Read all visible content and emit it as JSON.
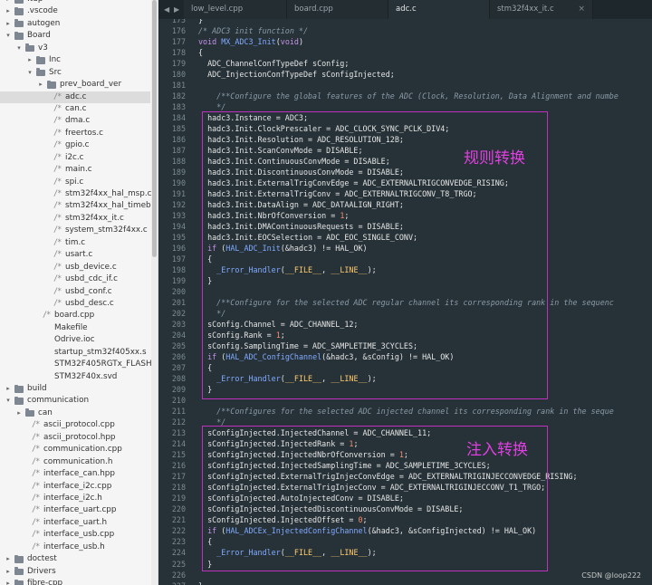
{
  "sidebar": {
    "items": [
      {
        "label": ".tup",
        "kind": "folder",
        "depth": 0,
        "expanded": false
      },
      {
        "label": ".vscode",
        "kind": "folder",
        "depth": 0,
        "expanded": false
      },
      {
        "label": "autogen",
        "kind": "folder",
        "depth": 0,
        "expanded": false
      },
      {
        "label": "Board",
        "kind": "folder",
        "depth": 0,
        "expanded": true
      },
      {
        "label": "v3",
        "kind": "folder",
        "depth": 1,
        "expanded": true
      },
      {
        "label": "Inc",
        "kind": "folder",
        "depth": 2,
        "expanded": false
      },
      {
        "label": "Src",
        "kind": "folder",
        "depth": 2,
        "expanded": true
      },
      {
        "label": "prev_board_ver",
        "kind": "folder",
        "depth": 3,
        "expanded": false
      },
      {
        "label": "adc.c",
        "kind": "file",
        "depth": 3,
        "icon": "/*",
        "selected": true
      },
      {
        "label": "can.c",
        "kind": "file",
        "depth": 3,
        "icon": "/*"
      },
      {
        "label": "dma.c",
        "kind": "file",
        "depth": 3,
        "icon": "/*"
      },
      {
        "label": "freertos.c",
        "kind": "file",
        "depth": 3,
        "icon": "/*"
      },
      {
        "label": "gpio.c",
        "kind": "file",
        "depth": 3,
        "icon": "/*"
      },
      {
        "label": "i2c.c",
        "kind": "file",
        "depth": 3,
        "icon": "/*"
      },
      {
        "label": "main.c",
        "kind": "file",
        "depth": 3,
        "icon": "/*"
      },
      {
        "label": "spi.c",
        "kind": "file",
        "depth": 3,
        "icon": "/*"
      },
      {
        "label": "stm32f4xx_hal_msp.c",
        "kind": "file",
        "depth": 3,
        "icon": "/*"
      },
      {
        "label": "stm32f4xx_hal_timebase_TIM.c",
        "kind": "file",
        "depth": 3,
        "icon": "/*"
      },
      {
        "label": "stm32f4xx_it.c",
        "kind": "file",
        "depth": 3,
        "icon": "/*"
      },
      {
        "label": "system_stm32f4xx.c",
        "kind": "file",
        "depth": 3,
        "icon": "/*"
      },
      {
        "label": "tim.c",
        "kind": "file",
        "depth": 3,
        "icon": "/*"
      },
      {
        "label": "usart.c",
        "kind": "file",
        "depth": 3,
        "icon": "/*"
      },
      {
        "label": "usb_device.c",
        "kind": "file",
        "depth": 3,
        "icon": "/*"
      },
      {
        "label": "usbd_cdc_if.c",
        "kind": "file",
        "depth": 3,
        "icon": "/*"
      },
      {
        "label": "usbd_conf.c",
        "kind": "file",
        "depth": 3,
        "icon": "/*"
      },
      {
        "label": "usbd_desc.c",
        "kind": "file",
        "depth": 3,
        "icon": "/*"
      },
      {
        "label": "board.cpp",
        "kind": "file",
        "depth": 2,
        "icon": "/*"
      },
      {
        "label": "Makefile",
        "kind": "file",
        "depth": 2,
        "icon": ""
      },
      {
        "label": "Odrive.ioc",
        "kind": "file",
        "depth": 2,
        "icon": ""
      },
      {
        "label": "startup_stm32f405xx.s",
        "kind": "file",
        "depth": 2,
        "icon": ""
      },
      {
        "label": "STM32F405RGTx_FLASH.ld",
        "kind": "file",
        "depth": 2,
        "icon": ""
      },
      {
        "label": "STM32F40x.svd",
        "kind": "file",
        "depth": 2,
        "icon": ""
      },
      {
        "label": "build",
        "kind": "folder",
        "depth": 0,
        "expanded": false
      },
      {
        "label": "communication",
        "kind": "folder",
        "depth": 0,
        "expanded": true
      },
      {
        "label": "can",
        "kind": "folder",
        "depth": 1,
        "expanded": false
      },
      {
        "label": "ascii_protocol.cpp",
        "kind": "file",
        "depth": 1,
        "icon": "/*"
      },
      {
        "label": "ascii_protocol.hpp",
        "kind": "file",
        "depth": 1,
        "icon": "/*"
      },
      {
        "label": "communication.cpp",
        "kind": "file",
        "depth": 1,
        "icon": "/*"
      },
      {
        "label": "communication.h",
        "kind": "file",
        "depth": 1,
        "icon": "/*"
      },
      {
        "label": "interface_can.hpp",
        "kind": "file",
        "depth": 1,
        "icon": "/*"
      },
      {
        "label": "interface_i2c.cpp",
        "kind": "file",
        "depth": 1,
        "icon": "/*"
      },
      {
        "label": "interface_i2c.h",
        "kind": "file",
        "depth": 1,
        "icon": "/*"
      },
      {
        "label": "interface_uart.cpp",
        "kind": "file",
        "depth": 1,
        "icon": "/*"
      },
      {
        "label": "interface_uart.h",
        "kind": "file",
        "depth": 1,
        "icon": "/*"
      },
      {
        "label": "interface_usb.cpp",
        "kind": "file",
        "depth": 1,
        "icon": "/*"
      },
      {
        "label": "interface_usb.h",
        "kind": "file",
        "depth": 1,
        "icon": "/*"
      },
      {
        "label": "doctest",
        "kind": "folder",
        "depth": 0,
        "expanded": false
      },
      {
        "label": "Drivers",
        "kind": "folder",
        "depth": 0,
        "expanded": false
      },
      {
        "label": "fibre-cpp",
        "kind": "folder",
        "depth": 0,
        "expanded": false
      }
    ]
  },
  "tabs": [
    {
      "label": "low_level.cpp",
      "active": false
    },
    {
      "label": "board.cpp",
      "active": false
    },
    {
      "label": "adc.c",
      "active": true
    },
    {
      "label": "stm32f4xx_it.c",
      "active": false
    }
  ],
  "tab_controls": {
    "left_arrow": "◀",
    "right_arrow": "▶",
    "close": "×"
  },
  "editor": {
    "lines": [
      {
        "n": "175",
        "text": "}"
      },
      {
        "n": "176",
        "text": "/* ADC3 init function */"
      },
      {
        "n": "177",
        "text": "void MX_ADC3_Init(void)"
      },
      {
        "n": "178",
        "text": "{"
      },
      {
        "n": "179",
        "text": "  ADC_ChannelConfTypeDef sConfig;"
      },
      {
        "n": "180",
        "text": "  ADC_InjectionConfTypeDef sConfigInjected;"
      },
      {
        "n": "181",
        "text": ""
      },
      {
        "n": "182",
        "text": "    /**Configure the global features of the ADC (Clock, Resolution, Data Alignment and numbe"
      },
      {
        "n": "183",
        "text": "    */"
      },
      {
        "n": "184",
        "text": "  hadc3.Instance = ADC3;"
      },
      {
        "n": "185",
        "text": "  hadc3.Init.ClockPrescaler = ADC_CLOCK_SYNC_PCLK_DIV4;"
      },
      {
        "n": "186",
        "text": "  hadc3.Init.Resolution = ADC_RESOLUTION_12B;"
      },
      {
        "n": "187",
        "text": "  hadc3.Init.ScanConvMode = DISABLE;"
      },
      {
        "n": "188",
        "text": "  hadc3.Init.ContinuousConvMode = DISABLE;"
      },
      {
        "n": "189",
        "text": "  hadc3.Init.DiscontinuousConvMode = DISABLE;"
      },
      {
        "n": "190",
        "text": "  hadc3.Init.ExternalTrigConvEdge = ADC_EXTERNALTRIGCONVEDGE_RISING;"
      },
      {
        "n": "191",
        "text": "  hadc3.Init.ExternalTrigConv = ADC_EXTERNALTRIGCONV_T8_TRGO;"
      },
      {
        "n": "192",
        "text": "  hadc3.Init.DataAlign = ADC_DATAALIGN_RIGHT;"
      },
      {
        "n": "193",
        "text": "  hadc3.Init.NbrOfConversion = 1;"
      },
      {
        "n": "194",
        "text": "  hadc3.Init.DMAContinuousRequests = DISABLE;"
      },
      {
        "n": "195",
        "text": "  hadc3.Init.EOCSelection = ADC_EOC_SINGLE_CONV;"
      },
      {
        "n": "196",
        "text": "  if (HAL_ADC_Init(&hadc3) != HAL_OK)"
      },
      {
        "n": "197",
        "text": "  {"
      },
      {
        "n": "198",
        "text": "    _Error_Handler(__FILE__, __LINE__);"
      },
      {
        "n": "199",
        "text": "  }"
      },
      {
        "n": "200",
        "text": ""
      },
      {
        "n": "201",
        "text": "    /**Configure for the selected ADC regular channel its corresponding rank in the sequenc"
      },
      {
        "n": "202",
        "text": "    */"
      },
      {
        "n": "203",
        "text": "  sConfig.Channel = ADC_CHANNEL_12;"
      },
      {
        "n": "204",
        "text": "  sConfig.Rank = 1;"
      },
      {
        "n": "205",
        "text": "  sConfig.SamplingTime = ADC_SAMPLETIME_3CYCLES;"
      },
      {
        "n": "206",
        "text": "  if (HAL_ADC_ConfigChannel(&hadc3, &sConfig) != HAL_OK)"
      },
      {
        "n": "207",
        "text": "  {"
      },
      {
        "n": "208",
        "text": "    _Error_Handler(__FILE__, __LINE__);"
      },
      {
        "n": "209",
        "text": "  }"
      },
      {
        "n": "210",
        "text": ""
      },
      {
        "n": "211",
        "text": "    /**Configures for the selected ADC injected channel its corresponding rank in the seque"
      },
      {
        "n": "212",
        "text": "    */"
      },
      {
        "n": "213",
        "text": "  sConfigInjected.InjectedChannel = ADC_CHANNEL_11;"
      },
      {
        "n": "214",
        "text": "  sConfigInjected.InjectedRank = 1;"
      },
      {
        "n": "215",
        "text": "  sConfigInjected.InjectedNbrOfConversion = 1;"
      },
      {
        "n": "216",
        "text": "  sConfigInjected.InjectedSamplingTime = ADC_SAMPLETIME_3CYCLES;"
      },
      {
        "n": "217",
        "text": "  sConfigInjected.ExternalTrigInjecConvEdge = ADC_EXTERNALTRIGINJECCONVEDGE_RISING;"
      },
      {
        "n": "218",
        "text": "  sConfigInjected.ExternalTrigInjecConv = ADC_EXTERNALTRIGINJECCONV_T1_TRGO;"
      },
      {
        "n": "219",
        "text": "  sConfigInjected.AutoInjectedConv = DISABLE;"
      },
      {
        "n": "220",
        "text": "  sConfigInjected.InjectedDiscontinuousConvMode = DISABLE;"
      },
      {
        "n": "221",
        "text": "  sConfigInjected.InjectedOffset = 0;"
      },
      {
        "n": "222",
        "text": "  if (HAL_ADCEx_InjectedConfigChannel(&hadc3, &sConfigInjected) != HAL_OK)"
      },
      {
        "n": "223",
        "text": "  {"
      },
      {
        "n": "224",
        "text": "    _Error_Handler(__FILE__, __LINE__);"
      },
      {
        "n": "225",
        "text": "  }"
      },
      {
        "n": "226",
        "text": ""
      },
      {
        "n": "227",
        "text": "}"
      }
    ]
  },
  "annotations": {
    "regular": "规则转换",
    "injected": "注入转换",
    "box_color": "#c02fc0",
    "text_color": "#e03fe0"
  },
  "watermark": "CSDN @loop222",
  "colors": {
    "editor_bg": "#263238",
    "keyword": "#c792ea",
    "function": "#82aaff",
    "comment": "#8a9aa6",
    "number": "#f78c6c",
    "macro": "#ffcb6b"
  }
}
